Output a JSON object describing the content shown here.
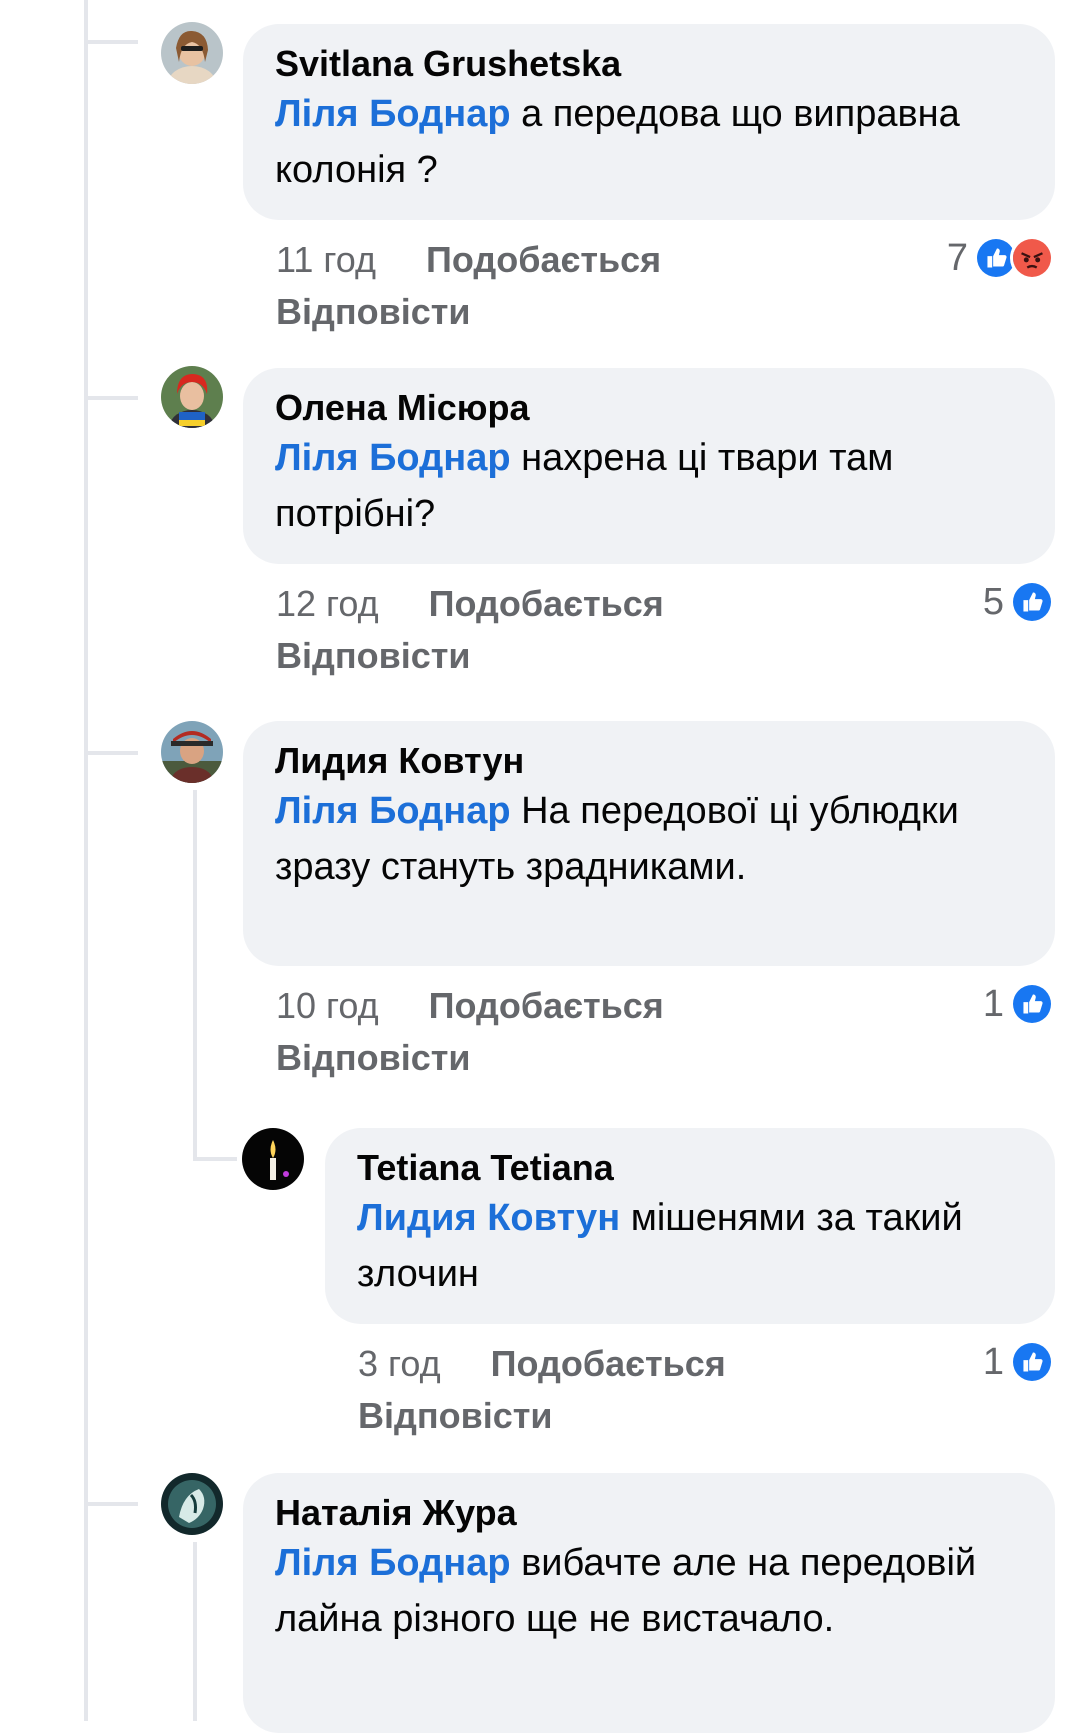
{
  "comments": [
    {
      "author": "Svitlana Grushetska",
      "mention": "Ліля Боднар",
      "text": " а передова що виправна колонія ?",
      "time": "11 год",
      "like_label": "Подобається",
      "reply_label": "Відповісти",
      "reaction_count": "7",
      "reactions": [
        "like-icon",
        "angry-icon"
      ]
    },
    {
      "author": "Олена Місюра",
      "mention": "Ліля Боднар",
      "text": " нахрена ці твари там потрібні?",
      "time": "12 год",
      "like_label": "Подобається",
      "reply_label": "Відповісти",
      "reaction_count": "5",
      "reactions": [
        "like-icon"
      ]
    },
    {
      "author": "Лидия Ковтун",
      "mention": "Ліля Боднар",
      "text": " На передової ці ублюдки зразу стануть зрадниками.",
      "time": "10 год",
      "like_label": "Подобається",
      "reply_label": "Відповісти",
      "reaction_count": "1",
      "reactions": [
        "like-icon"
      ]
    },
    {
      "author": "Tetiana Tetiana",
      "mention": "Лидия Ковтун",
      "text": " мішенями за такий злочин",
      "time": "3 год",
      "like_label": "Подобається",
      "reply_label": "Відповісти",
      "reaction_count": "1",
      "reactions": [
        "like-icon"
      ]
    },
    {
      "author": "Наталія Жура",
      "mention": "Ліля Боднар",
      "text": " вибачте але на передовій лайна різного ще не вистачало."
    }
  ],
  "colors": {
    "mention": "#1c6fd8",
    "bubble": "#f0f2f5",
    "meta_text": "#65676b",
    "like": "#1877f2",
    "angry": "#f0594a"
  }
}
